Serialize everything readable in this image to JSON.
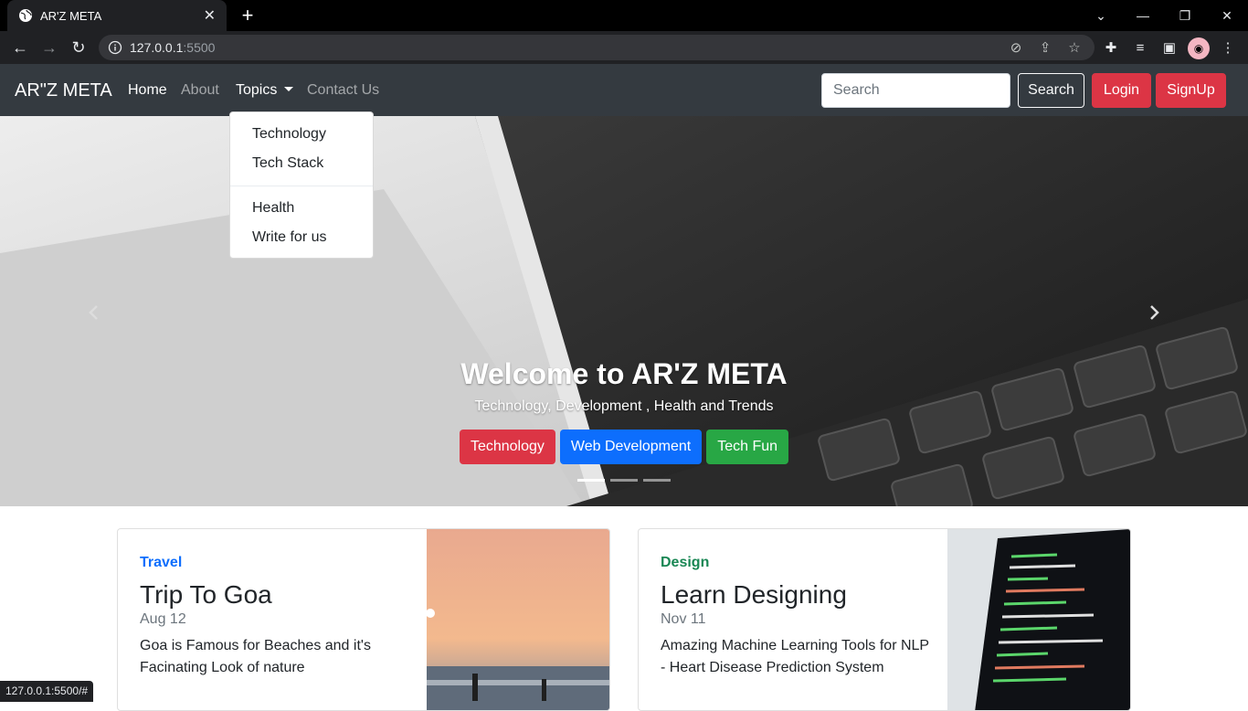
{
  "browser": {
    "tab_title": "AR'Z META",
    "url_host": "127.0.0.1",
    "url_port": ":5500",
    "status_url": "127.0.0.1:5500/#"
  },
  "navbar": {
    "brand": "AR\"Z META",
    "links": [
      "Home",
      "About",
      "Topics",
      "Contact Us"
    ],
    "search_placeholder": "Search",
    "search_button": "Search",
    "login_button": "Login",
    "signup_button": "SignUp"
  },
  "dropdown": {
    "items_top": [
      "Technology",
      "Tech Stack"
    ],
    "items_bottom": [
      "Health",
      "Write for us"
    ]
  },
  "hero": {
    "title": "Welcome to AR'Z META",
    "subtitle": "Technology, Development , Health and Trends",
    "buttons": [
      "Technology",
      "Web Development",
      "Tech Fun"
    ]
  },
  "cards": [
    {
      "category": "Travel",
      "category_color": "#0d6efd",
      "title": "Trip To Goa",
      "date": "Aug 12",
      "text": "Goa is Famous for Beaches and it's Facinating Look of nature"
    },
    {
      "category": "Design",
      "category_color": "#198754",
      "title": "Learn Designing",
      "date": "Nov 11",
      "text": "Amazing Machine Learning Tools for NLP - Heart Disease Prediction System"
    }
  ],
  "colors": {
    "danger": "#dc3545",
    "primary": "#0d6efd",
    "success": "#28a745",
    "navbar": "#343a40"
  }
}
